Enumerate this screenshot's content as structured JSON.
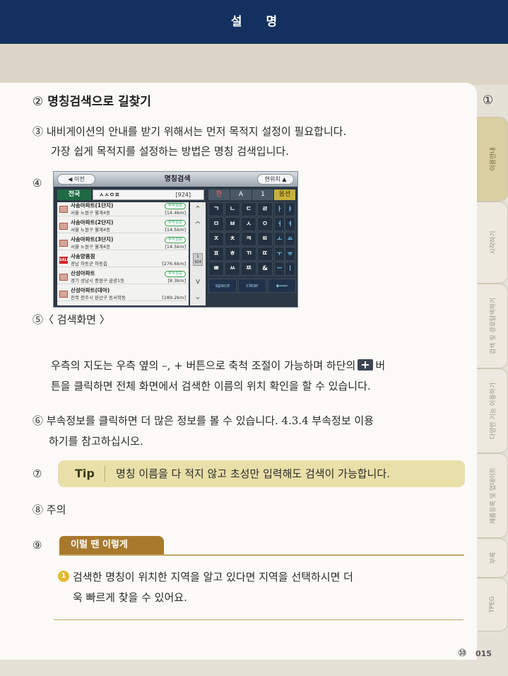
{
  "header": {
    "title": "설 명"
  },
  "section": {
    "number": "②",
    "title": "명칭검색으로 길찾기"
  },
  "intro": {
    "line1": "③ 내비게이션의 안내를 받기 위해서는 먼저 목적지 설정이 필요합니다.",
    "line2": "가장 쉽게 목적지를 설정하는 방법은 명칭 검색입니다."
  },
  "figure": {
    "marker": "④",
    "caption": "⑤〈 검색화면 〉",
    "screen": {
      "back_label": "이전",
      "title": "명칭검색",
      "current_label": "현위치",
      "region": "전국",
      "query": "ㅅㅅㅇㅍ",
      "count": "[924]",
      "results": [
        {
          "name": "사송아파트(1단지)",
          "address": "서울 노원구 월계4동",
          "distance": "[14.4km]",
          "badge": "부속정보",
          "icon": "building"
        },
        {
          "name": "사송아파트(2단지)",
          "address": "서울 노원구 월계4동",
          "distance": "[14.5km]",
          "badge": "부속정보",
          "icon": "building"
        },
        {
          "name": "사송아파트(3단지)",
          "address": "서울 노원구 월계4동",
          "distance": "[14.5km]",
          "badge": "부속정보",
          "icon": "building"
        },
        {
          "name": "사송양품점",
          "address": "경남 하동군 하동읍",
          "distance": "[276.6km]",
          "badge": "",
          "icon": "sale",
          "icon_text": "SALE"
        },
        {
          "name": "산성아파트",
          "address": "경기 성남시 중원구 금광1동",
          "distance": "[8.3km]",
          "badge": "부속정보",
          "icon": "building"
        },
        {
          "name": "산성아파트(대아)",
          "address": "전북 전주시 완산구 동서학동",
          "distance": "[189.2km]",
          "badge": "",
          "icon": "building"
        }
      ],
      "page_indicator": {
        "current": "1",
        "total": "924"
      },
      "keyboard_tabs": [
        "한",
        "A",
        "1",
        "옵션"
      ],
      "keys": [
        [
          "ㄱ",
          "ㄴ",
          "ㄷ",
          "ㄹ"
        ],
        [
          "ㅁ",
          "ㅂ",
          "ㅅ",
          "ㅇ"
        ],
        [
          "ㅈ",
          "ㅊ",
          "ㅋ",
          "ㅌ"
        ],
        [
          "ㅍ",
          "ㅎ",
          "ㄲ",
          "ㄸ"
        ],
        [
          "ㅃ",
          "ㅆ",
          "ㅉ",
          "&"
        ]
      ],
      "vowel_keys": [
        [
          "ㅏ",
          "ㅑ"
        ],
        [
          "ㅓ",
          "ㅕ"
        ],
        [
          "ㅗ",
          "ㅛ"
        ],
        [
          "ㅜ",
          "ㅠ"
        ],
        [
          "ㅡ",
          "ㅣ"
        ]
      ],
      "function_keys": [
        "space",
        "clear",
        "⟵"
      ]
    }
  },
  "para": {
    "line1_a": "우측의 지도는 우측 옆의 –, + 버튼으로 축척 조절이 가능하며 하단의",
    "line1_b": "버",
    "line2": "튼을 클릭하면 전체 화면에서 검색한 이름의 위치 확인을 할 수 있습니다."
  },
  "item6": {
    "line1": "⑥ 부속정보를 클릭하면 더 많은 정보를 볼 수 있습니다. 4.3.4 부속정보 이용",
    "line2": "하기를 참고하십시오."
  },
  "tip": {
    "marker": "⑦",
    "label": "Tip",
    "text": "명칭 이름을 다 적지 않고 초성만 입력해도 검색이 가능합니다."
  },
  "item8": {
    "text": "⑧ 주의"
  },
  "if_box": {
    "marker": "⑨",
    "title": "이럴 땐 이렇게",
    "number": "1",
    "line1": "검색한 명칭이 위치한 지역을 알고 있다면 지역을 선택하시면 더",
    "line2": "욱 빠르게 찾을 수 있어요."
  },
  "footer": {
    "marker": "⑩",
    "page_number": "015"
  },
  "side": {
    "marker": "①",
    "tabs": [
      "이용안내",
      "시작하기",
      "검색 및 경로탐색하기",
      "다양한 기능 이용하기",
      "제품등록 및 업데이트",
      "부록",
      "TPEG"
    ],
    "active_index": 0
  }
}
